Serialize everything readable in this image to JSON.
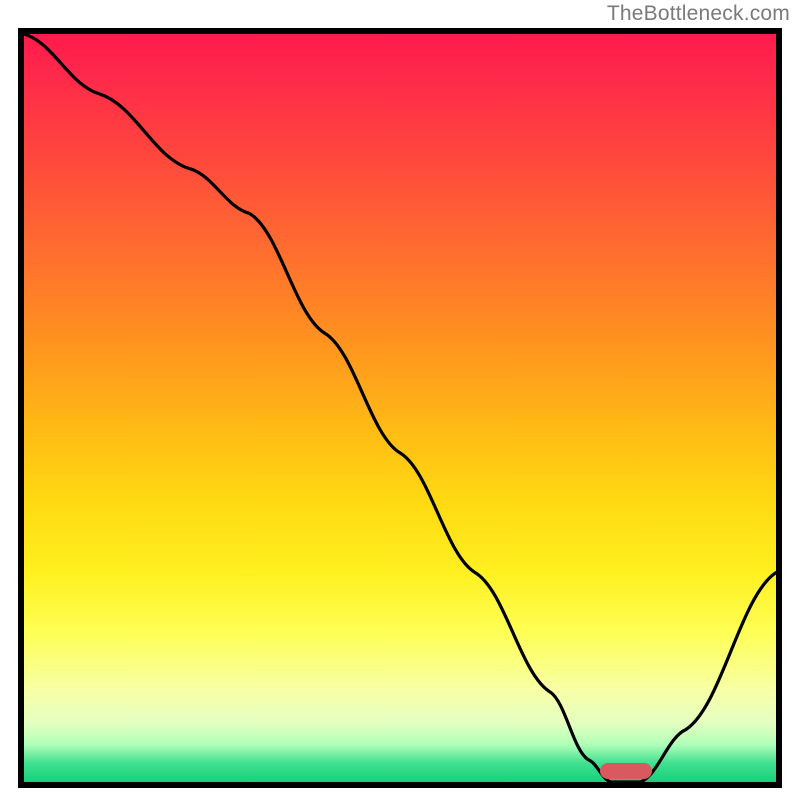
{
  "watermark": "TheBottleneck.com",
  "chart_data": {
    "type": "line",
    "title": "",
    "xlabel": "",
    "ylabel": "",
    "xlim": [
      0,
      100
    ],
    "ylim": [
      0,
      100
    ],
    "grid": false,
    "background": "heatmap-gradient",
    "gradient_stops": [
      {
        "pos": 0.0,
        "color": "#ff1a4d"
      },
      {
        "pos": 0.14,
        "color": "#ff4040"
      },
      {
        "pos": 0.4,
        "color": "#ff8f20"
      },
      {
        "pos": 0.62,
        "color": "#ffd812"
      },
      {
        "pos": 0.8,
        "color": "#feff55"
      },
      {
        "pos": 0.92,
        "color": "#e4ffc0"
      },
      {
        "pos": 1.0,
        "color": "#16d07a"
      }
    ],
    "series": [
      {
        "name": "bottleneck-curve",
        "x": [
          0,
          10,
          22,
          30,
          40,
          50,
          60,
          70,
          75,
          78,
          82,
          88,
          100
        ],
        "y": [
          100,
          92,
          82,
          76,
          60,
          44,
          28,
          12,
          3,
          0,
          0,
          7,
          28
        ]
      }
    ],
    "optimum_marker": {
      "x": 80,
      "y": 1
    }
  }
}
